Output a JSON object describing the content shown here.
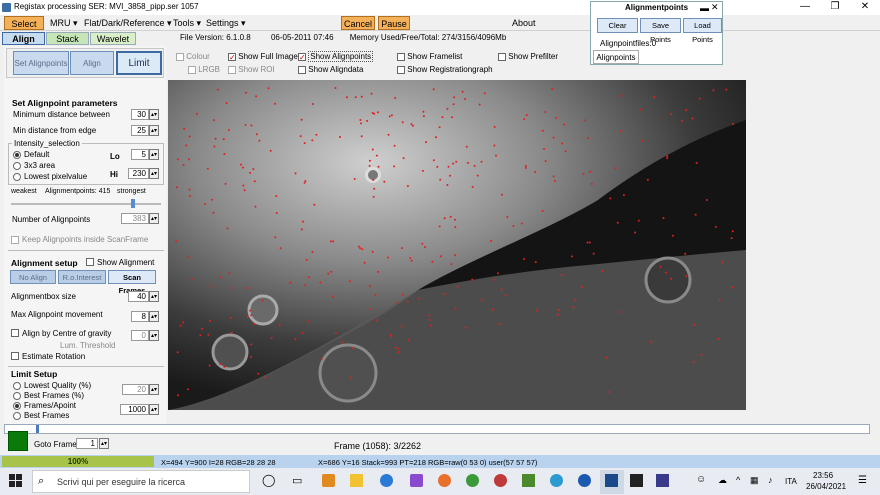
{
  "window": {
    "title": "Registax processing SER: MVI_3858_pipp.ser 1057",
    "controls": [
      "—",
      "❐",
      "✕"
    ]
  },
  "menu": {
    "select": "Select",
    "mru": "MRU ▾",
    "flat": "Flat/Dark/Reference ▾",
    "tools": "Tools ▾",
    "settings": "Settings ▾",
    "cancel": "Cancel",
    "pause": "Pause",
    "about": "About"
  },
  "tabs": [
    "Align",
    "Stack",
    "Wavelet"
  ],
  "info": {
    "file_version": "File Version: 6.1.0.8",
    "date": "06-05-2011 07:46",
    "memory": "Memory Used/Free/Total: 274/3156/4096Mb"
  },
  "left": {
    "btn_set": "Set Alignpoints",
    "btn_align": "Align",
    "btn_limit": "Limit",
    "set_params": "Set Alignpoint parameters",
    "min_dist": "Minimum distance between",
    "min_dist_val": "30",
    "min_edge": "Min distance from edge",
    "min_edge_val": "25",
    "intensity": "Intensity_selection",
    "r_default": "Default",
    "r_3x3": "3x3 area",
    "r_lowest": "Lowest pixelvalue",
    "lo": "Lo",
    "lo_val": "5",
    "hi": "Hi",
    "hi_val": "230",
    "weakest": "weakest",
    "ap_count": "Alignmentpoints: 415",
    "strongest": "strongest",
    "num_ap": "Number of Alignpoints",
    "num_ap_val": "383",
    "keep_ap": "Keep Alignpoints inside ScanFrame",
    "align_setup": "Alignment setup",
    "show_alignment": "Show Alignment",
    "no_align": "No Align",
    "roi": "R.o.Interest",
    "scan_frames": "Scan Frames",
    "box_size": "Alignmentbox size",
    "box_size_val": "40",
    "max_move": "Max Alignpoint movement",
    "max_move_val": "8",
    "cog": "Align by Centre of gravity",
    "cog_val": "0",
    "lum_thr": "Lum. Threshold",
    "est_rot": "Estimate Rotation",
    "limit_setup": "Limit Setup",
    "lowest_q": "Lowest Quality (%)",
    "lowest_q_val": "20",
    "best_pct": "Best Frames (%)",
    "frames_ap": "Frames/Apoint",
    "frames_ap_val": "1000",
    "best_frames": "Best Frames"
  },
  "options": {
    "colour": "Colour",
    "lrgb": "LRGB",
    "full_image": "Show Full Image",
    "show_roi": "Show ROI",
    "show_ap": "Show Alignpoints",
    "show_ad": "Show Aligndata",
    "framelist": "Show Framelist",
    "reggraph": "Show Registrationgraph",
    "prefilter": "Show Prefilter"
  },
  "ap_window": {
    "title": "Alignmentpoints",
    "clear": "Clear",
    "save": "Save Points",
    "load": "Load Points",
    "files": "Alignpointfiles:0",
    "tab": "Alignpoints"
  },
  "bottom": {
    "goto": "Goto Frame",
    "goto_val": "1",
    "frame": "Frame (1058): 3/2262"
  },
  "status": {
    "progress": "100%",
    "pix1": "X=494 Y=900 I=28 RGB=28 28 28",
    "pix2": "X=686 Y=16 Stack=993 PT=218 RGB=raw(0 53 0) user(57 57 57)"
  },
  "taskbar": {
    "search": "Scrivi qui per eseguire la ricerca",
    "lang": "ITA",
    "time": "23:56",
    "date": "26/04/2021"
  },
  "colors": {
    "accent_orange": "#f5b05a",
    "status_blue": "#b9d3ee",
    "green_swatch": "#0a7a0a",
    "alignpoint_red": "#e02020"
  }
}
